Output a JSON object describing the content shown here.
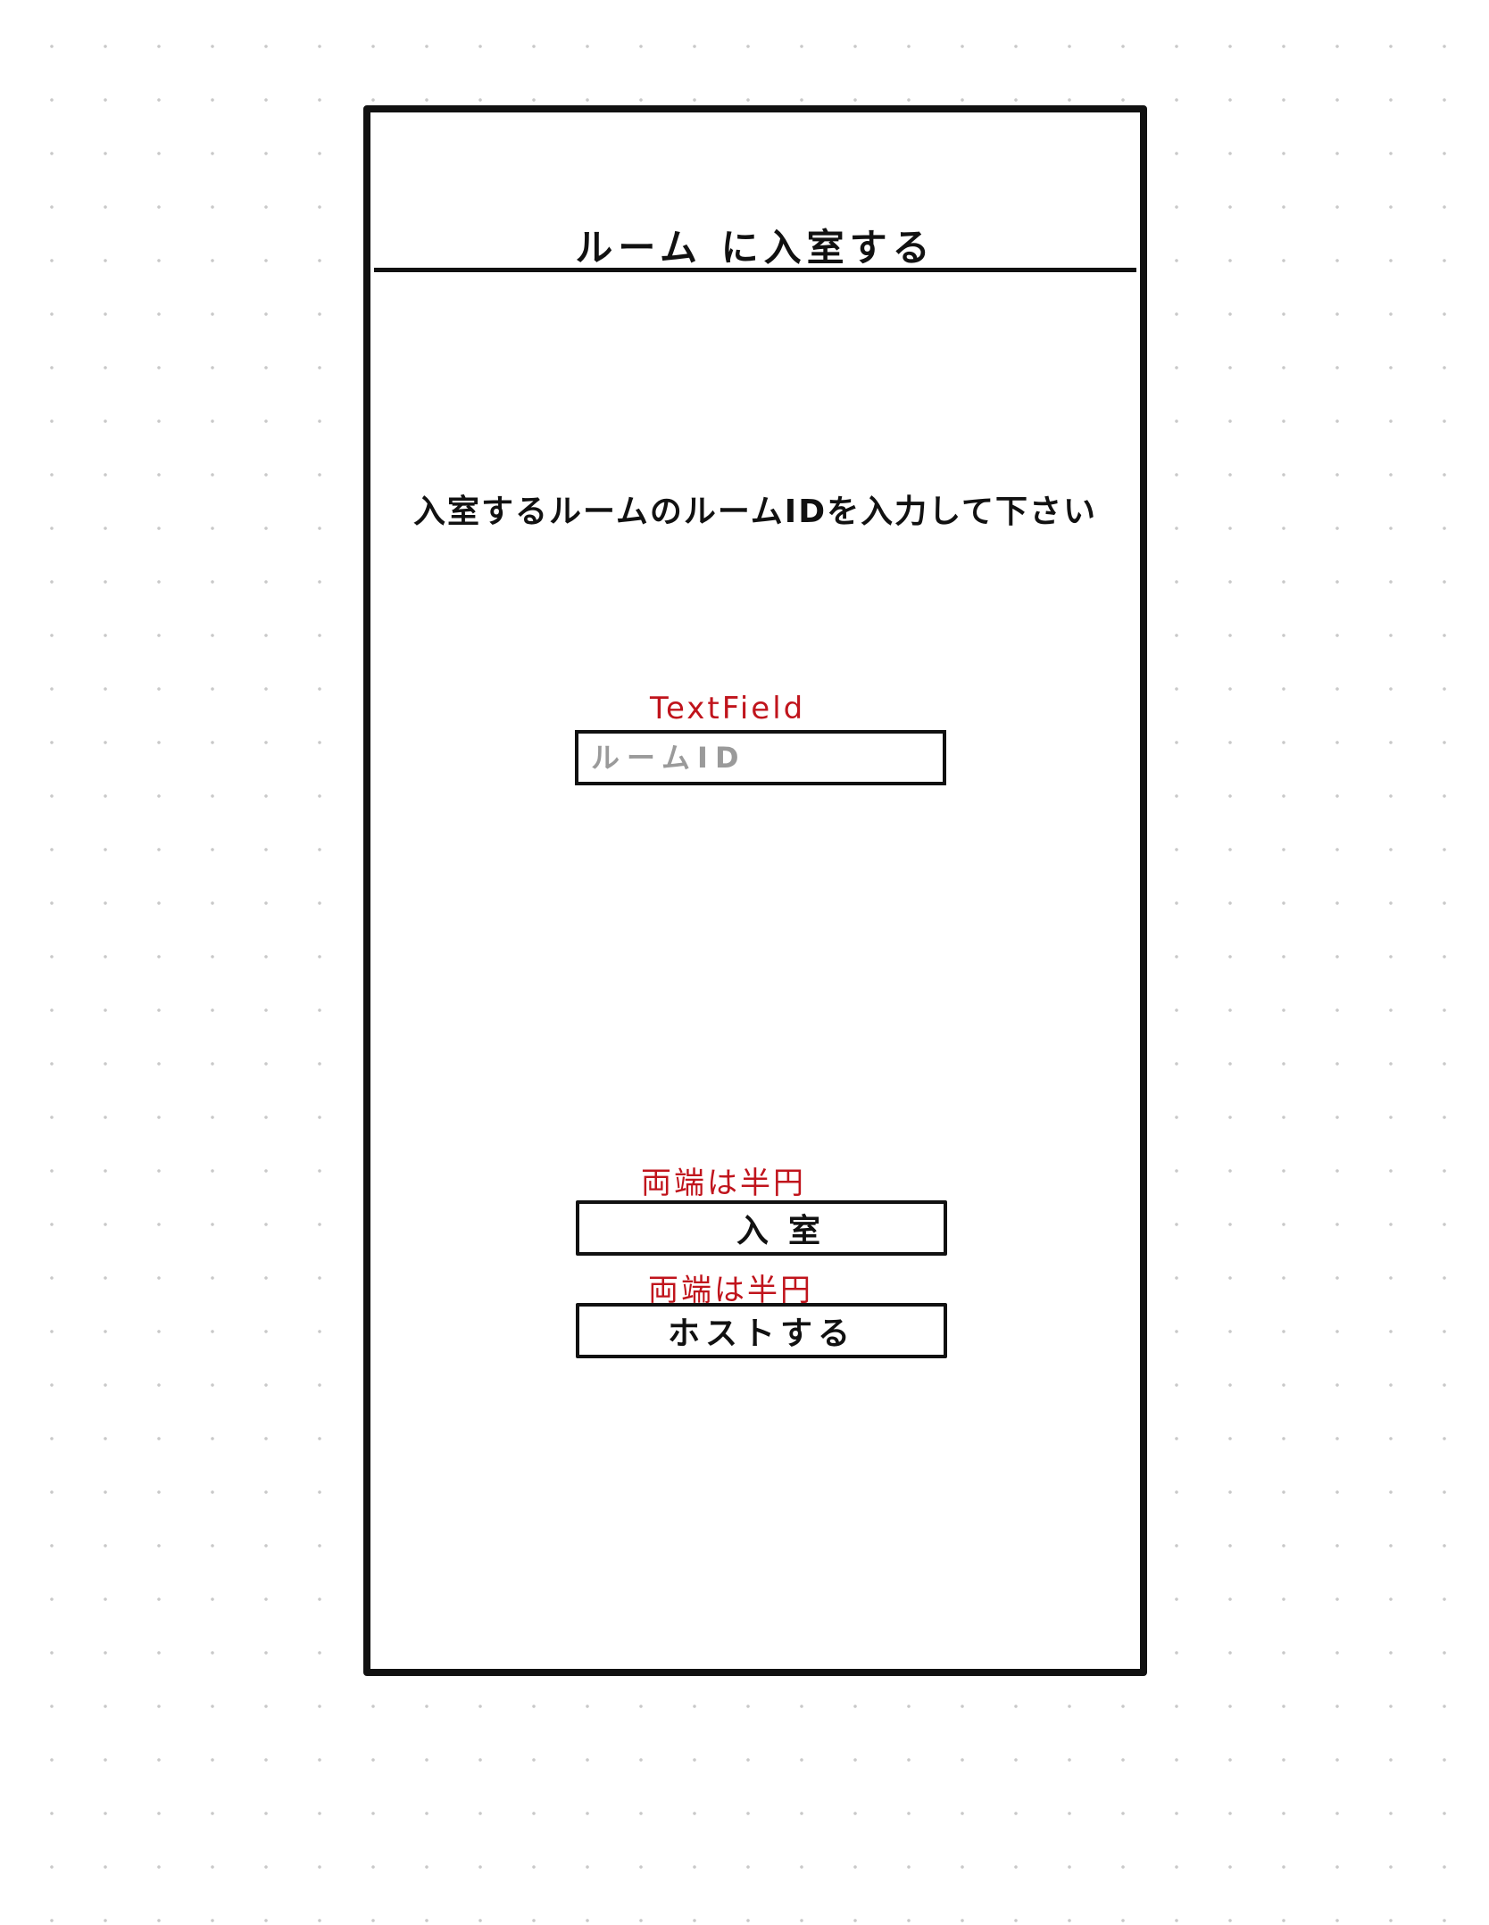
{
  "header": {
    "title": "ルーム に入室する"
  },
  "main": {
    "instruction": "入室するルームのルームIDを入力して下さい",
    "room_id_input": {
      "annotation": "TextField",
      "placeholder": "ルームID",
      "value": ""
    },
    "join_button": {
      "annotation": "両端は半円",
      "label": "入室"
    },
    "host_button": {
      "annotation": "両端は半円",
      "label": "ホストする"
    }
  },
  "colors": {
    "ink": "#111111",
    "annotation": "#c0141c",
    "placeholder": "#9a9a9a"
  }
}
